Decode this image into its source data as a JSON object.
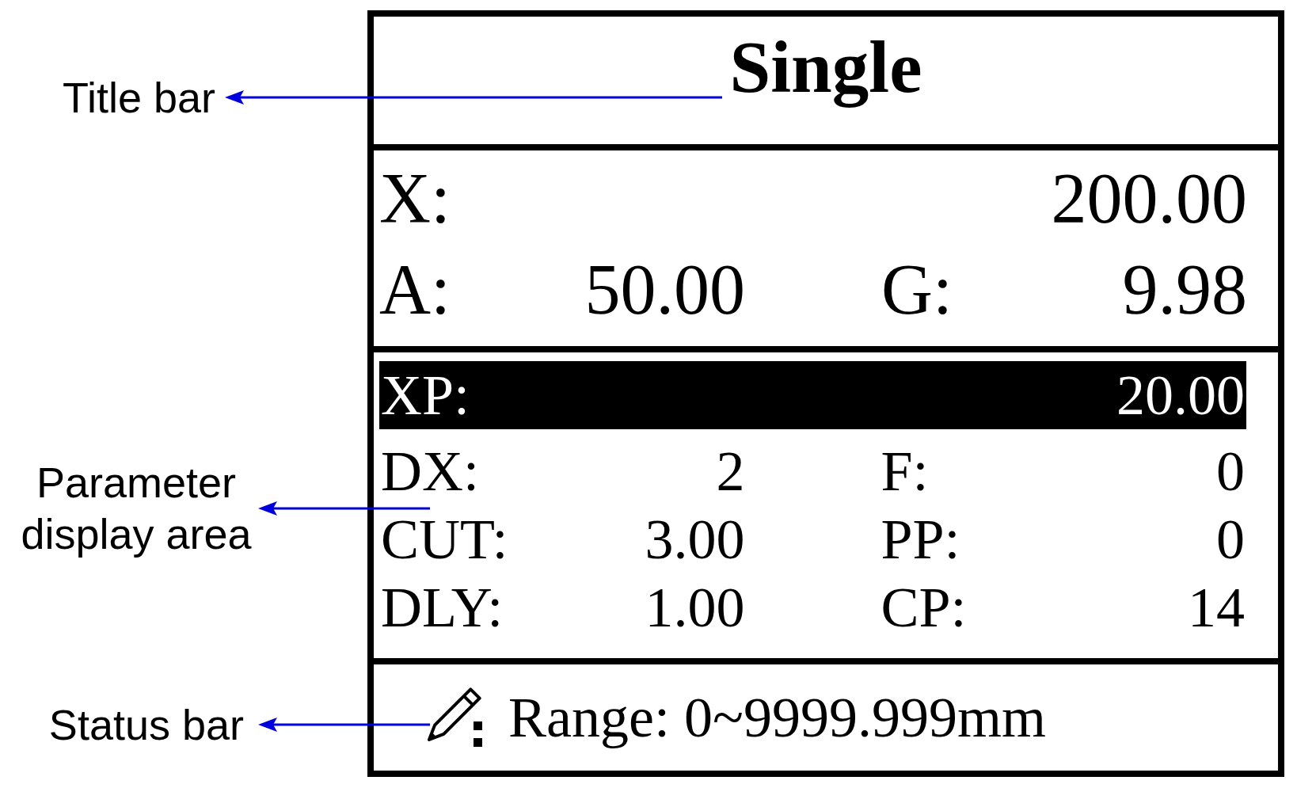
{
  "title_bar": {
    "callout": "Title bar",
    "title": "Single"
  },
  "readout": {
    "rows": [
      {
        "items": [
          {
            "label": "X:",
            "value": "200.00"
          }
        ]
      },
      {
        "items": [
          {
            "label": "A:",
            "value": "50.00"
          },
          {
            "label": "G:",
            "value": "9.98"
          }
        ]
      }
    ]
  },
  "parameter_area": {
    "callout": "Parameter display area",
    "rows": [
      {
        "items": [
          {
            "label": "XP:",
            "value": "20.00",
            "selected": true
          }
        ]
      },
      {
        "items": [
          {
            "label": "DX:",
            "value": "2",
            "selected": false
          },
          {
            "label": "F:",
            "value": "0",
            "selected": false
          }
        ]
      },
      {
        "items": [
          {
            "label": "CUT:",
            "value": "3.00",
            "selected": false
          },
          {
            "label": "PP:",
            "value": "0",
            "selected": false
          }
        ]
      },
      {
        "items": [
          {
            "label": "DLY:",
            "value": "1.00",
            "selected": false
          },
          {
            "label": "CP:",
            "value": "14",
            "selected": false
          }
        ]
      }
    ]
  },
  "status_bar": {
    "callout": "Status bar",
    "text": "Range: 0~9999.999mm"
  }
}
